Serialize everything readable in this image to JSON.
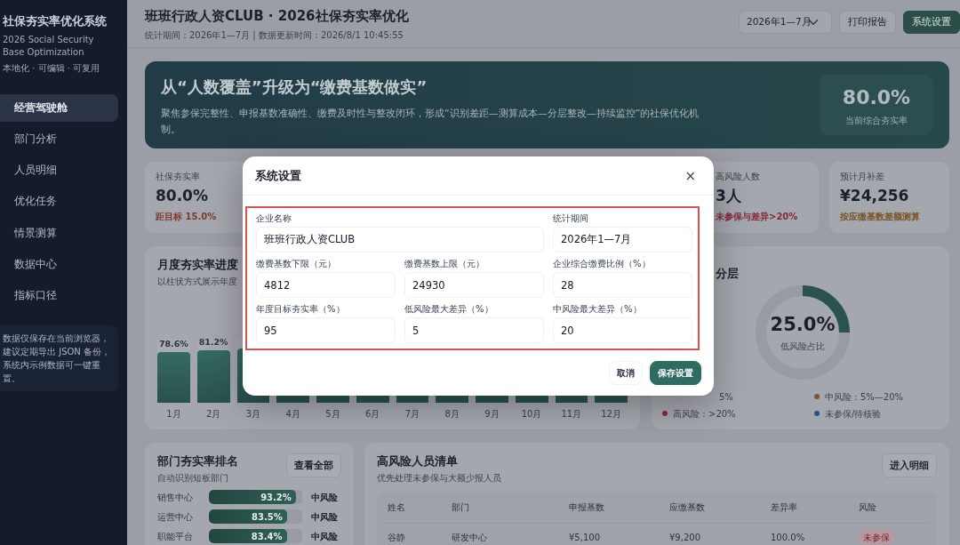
{
  "sidebar": {
    "title": "社保夯实率优化系统",
    "subtitle": "2026 Social Security Base Optimization",
    "tagline": "本地化 · 可编辑 · 可复用",
    "items": [
      {
        "label": "经营驾驶舱",
        "selected": true
      },
      {
        "label": "部门分析",
        "selected": false
      },
      {
        "label": "人员明细",
        "selected": false
      },
      {
        "label": "优化任务",
        "selected": false
      },
      {
        "label": "情景测算",
        "selected": false
      },
      {
        "label": "数据中心",
        "selected": false
      },
      {
        "label": "指标口径",
        "selected": false
      }
    ],
    "note": "数据仅保存在当前浏览器，建议定期导出 JSON 备份，系统内示例数据可一键重置。"
  },
  "header": {
    "title": "班班行政人资CLUB · 2026社保夯实率优化",
    "meta": "统计期间：2026年1—7月 | 数据更新时间：2026/8/1 10:45:55",
    "period_select": "2026年1—7月",
    "buttons": [
      {
        "label": "打印报告",
        "kind": "outline"
      },
      {
        "label": "系统设置",
        "kind": "primary"
      }
    ]
  },
  "hero": {
    "title": "从“人数覆盖”升级为“缴费基数做实”",
    "text": "聚焦参保完整性、申报基数准确性、缴费及时性与整改闭环，形成“识别差距—测算成本—分层整改—持续监控”的社保优化机制。",
    "metric": "80.0%",
    "metric_label": "当前综合夯实率"
  },
  "kpis": [
    {
      "label": "社保夯实率",
      "value": "80.0%",
      "note": "距目标 15.0%",
      "color": "#7e3a2c"
    },
    {
      "label": "高风险人数",
      "value": "3人",
      "note": "未参保与差异>20%",
      "color": "#84283a"
    },
    {
      "label": "预计月补差",
      "value": "¥24,256",
      "note": "按应缴基数差额测算",
      "color": "#7a5320"
    }
  ],
  "monthly": {
    "title": "月度夯实率进度",
    "subtitle": "以柱状方式展示年度",
    "bars": [
      {
        "month": "1月",
        "value_label": "78.6%",
        "level": 0.786
      },
      {
        "month": "2月",
        "value_label": "81.2%",
        "level": 0.812
      },
      {
        "month": "3月",
        "level": 0.84
      },
      {
        "month": "4月",
        "level": 0.86
      },
      {
        "month": "5月",
        "level": 0.87
      },
      {
        "month": "6月",
        "level": 0.88
      },
      {
        "month": "7月",
        "level": 0.89
      },
      {
        "month": "8月",
        "level": 0.6
      },
      {
        "month": "9月",
        "level": 0.6
      },
      {
        "month": "10月",
        "level": 0.6
      },
      {
        "month": "11月",
        "level": 0.6
      },
      {
        "month": "12月",
        "level": 0.6
      }
    ]
  },
  "risk_mix": {
    "title": "分层",
    "center_value": "25.0%",
    "center_label": "低风险占比",
    "level": 0.25,
    "legend": [
      {
        "label": "5%"
      },
      {
        "label": "中风险：5%—20%",
        "color": "#7a5530"
      },
      {
        "label": "高风险：>20%",
        "color": "#86283a"
      },
      {
        "label": "未参保/待核验",
        "color": "#2d4f8c"
      }
    ]
  },
  "ranking": {
    "title": "部门夯实率排名",
    "subtitle": "自动识别短板部门",
    "button": "查看全部",
    "rows": [
      {
        "dept": "销售中心",
        "value": "93.2%",
        "level": 0.932,
        "risk": "中风险"
      },
      {
        "dept": "运营中心",
        "value": "83.5%",
        "level": 0.835,
        "risk": "中风险"
      },
      {
        "dept": "职能平台",
        "value": "83.4%",
        "level": 0.834,
        "risk": "中风险"
      }
    ]
  },
  "high_risk": {
    "title": "高风险人员清单",
    "subtitle": "优先处理未参保与大额少报人员",
    "button": "进入明细",
    "columns": [
      "姓名",
      "部门",
      "申报基数",
      "应缴基数",
      "差异率",
      "风险"
    ],
    "rows": [
      {
        "cells": [
          "谷静",
          "研发中心",
          "¥5,100",
          "¥9,200",
          "100.0%"
        ],
        "risk": "未参保"
      }
    ]
  },
  "modal": {
    "title": "系统设置",
    "close": "×",
    "form_highlighted": true,
    "fields": [
      {
        "label": "企业名称",
        "value": "班班行政人资CLUB",
        "kind": "wide"
      },
      {
        "label": "统计期间",
        "value": "2026年1—7月",
        "kind": "normal"
      },
      {
        "label": "缴费基数下限（元）",
        "value": "4812",
        "kind": "normal"
      },
      {
        "label": "缴费基数上限（元）",
        "value": "24930",
        "kind": "normal"
      },
      {
        "label": "企业综合缴费比例（%）",
        "value": "28",
        "kind": "normal"
      },
      {
        "label": "年度目标夯实率（%）",
        "value": "95",
        "kind": "normal"
      },
      {
        "label": "低风险最大差异（%）",
        "value": "5",
        "kind": "normal"
      },
      {
        "label": "中风险最大差异（%）",
        "value": "20",
        "kind": "normal"
      }
    ],
    "buttons": [
      {
        "label": "取消",
        "kind": "light"
      },
      {
        "label": "保存设置",
        "kind": "primary"
      }
    ]
  }
}
